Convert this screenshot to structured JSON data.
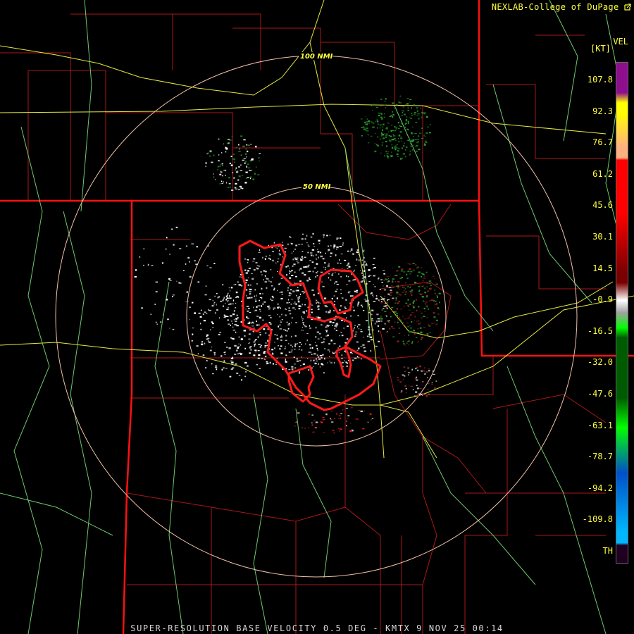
{
  "credit": "NEXLAB-College of DuPage",
  "product": "VEL",
  "unit": "[KT]",
  "footer": "SUPER-RESOLUTION BASE VELOCITY 0.5 DEG - KMTX 9 NOV 25 00:14",
  "range_rings": [
    "50 NMI",
    "100 NMI"
  ],
  "legend_values": [
    "107.8",
    "92.3",
    "76.7",
    "61.2",
    "45.6",
    "30.1",
    "14.5",
    "-0.9",
    "-16.5",
    "-32.0",
    "-47.6",
    "-63.1",
    "-78.7",
    "-94.2",
    "-109.8",
    "TH"
  ],
  "legend_colors": [
    "#8e0e8e",
    "#ffff00",
    "#ffb080",
    "#ff0000",
    "#7a0000",
    "#ffffff",
    "#a0a0a0",
    "#00ff00",
    "#005a00",
    "#0050c8",
    "#00b8ff",
    "#200020"
  ],
  "icons": {
    "external_link": "external-link-icon"
  }
}
